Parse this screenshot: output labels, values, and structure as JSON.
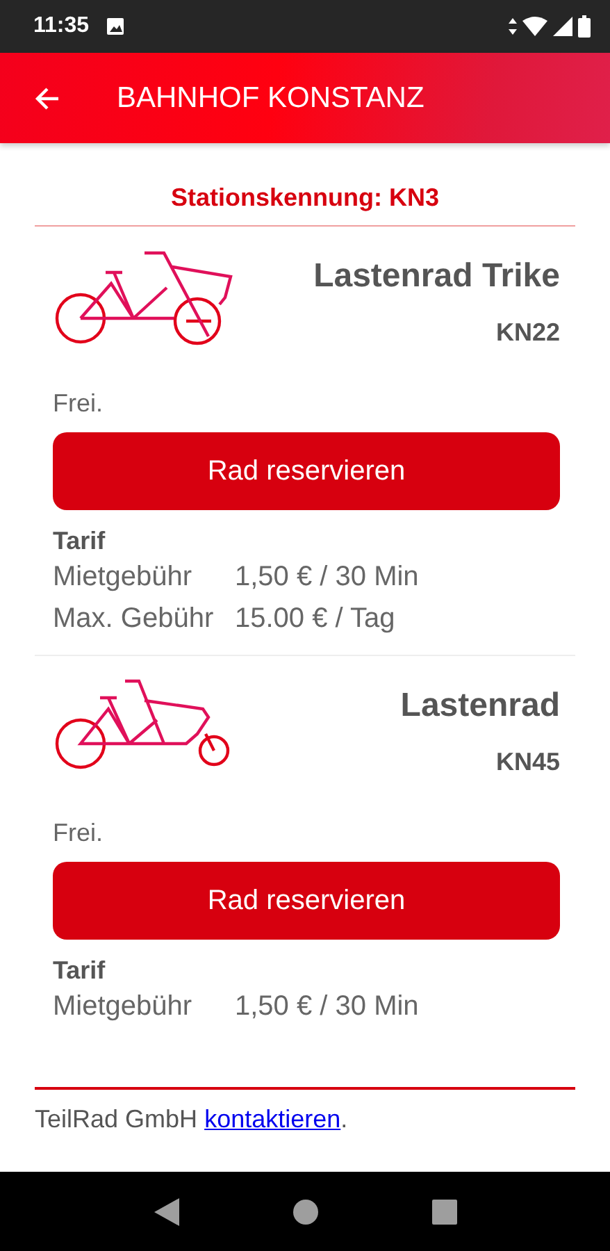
{
  "status_bar": {
    "time": "11:35"
  },
  "app_bar": {
    "title": "BAHNHOF KONSTANZ"
  },
  "station": {
    "label": "Stationskennung: KN3"
  },
  "bikes": [
    {
      "kind": "trike",
      "name": "Lastenrad Trike",
      "code": "KN22",
      "status": "Frei.",
      "button": "Rad reservieren",
      "tariff_title": "Tarif",
      "tariff": [
        {
          "label": "Mietgebühr",
          "value": "1,50 € / 30 Min"
        },
        {
          "label": "Max. Gebühr",
          "value": "15.00 € / Tag"
        }
      ]
    },
    {
      "kind": "cargo",
      "name": "Lastenrad",
      "code": "KN45",
      "status": "Frei.",
      "button": "Rad reservieren",
      "tariff_title": "Tarif",
      "tariff": [
        {
          "label": "Mietgebühr",
          "value": "1,50 € / 30 Min"
        }
      ]
    }
  ],
  "footer": {
    "company": "TeilRad GmbH",
    "link": "kontaktieren",
    "end": "."
  }
}
